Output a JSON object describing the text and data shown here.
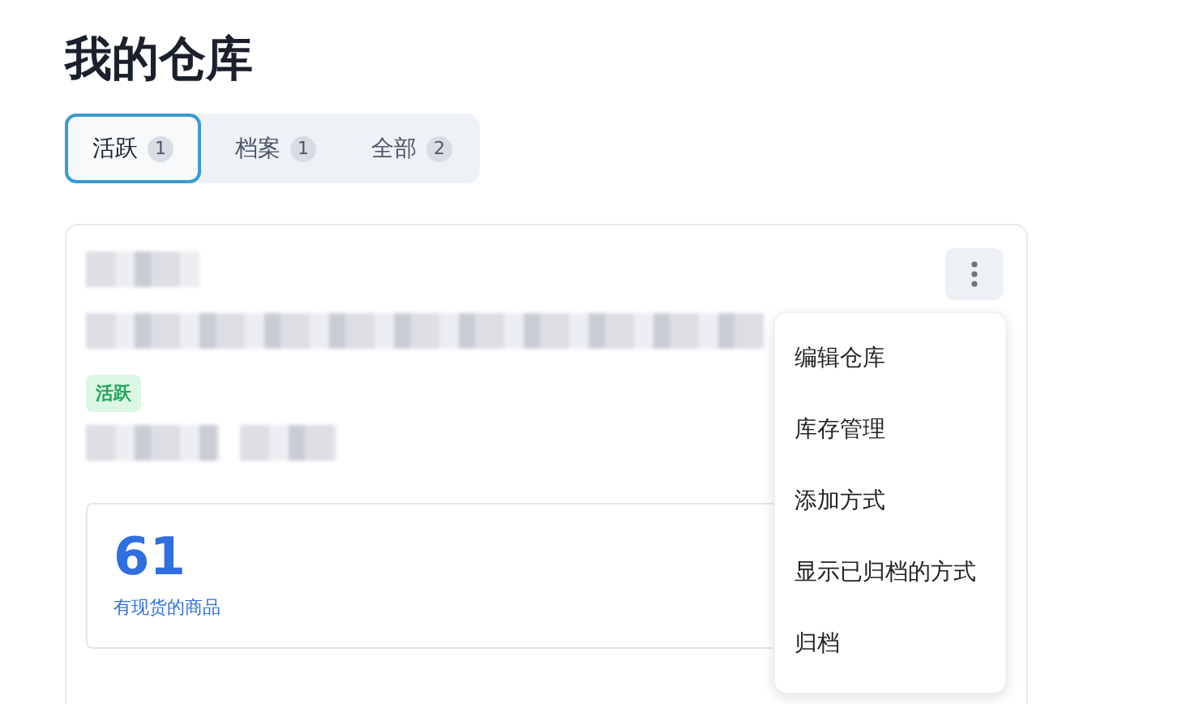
{
  "page_title": "我的仓库",
  "tabs": [
    {
      "label": "活跃",
      "count": "1",
      "selected": true
    },
    {
      "label": "档案",
      "count": "1",
      "selected": false
    },
    {
      "label": "全部",
      "count": "2",
      "selected": false
    }
  ],
  "card": {
    "title": {
      "kind": "blurred"
    },
    "description": {
      "kind": "blurred"
    },
    "status": {
      "label": "活跃",
      "color": "#22a55a"
    },
    "meta": [
      {
        "kind": "blurred"
      },
      {
        "kind": "blurred"
      }
    ],
    "stat": {
      "value": "61",
      "label": "有现货的商品"
    },
    "menu": {
      "open": true,
      "items": [
        {
          "label": "编辑仓库"
        },
        {
          "label": "库存管理"
        },
        {
          "label": "添加方式"
        },
        {
          "label": "显示已归档的方式"
        },
        {
          "label": "归档"
        }
      ]
    }
  }
}
